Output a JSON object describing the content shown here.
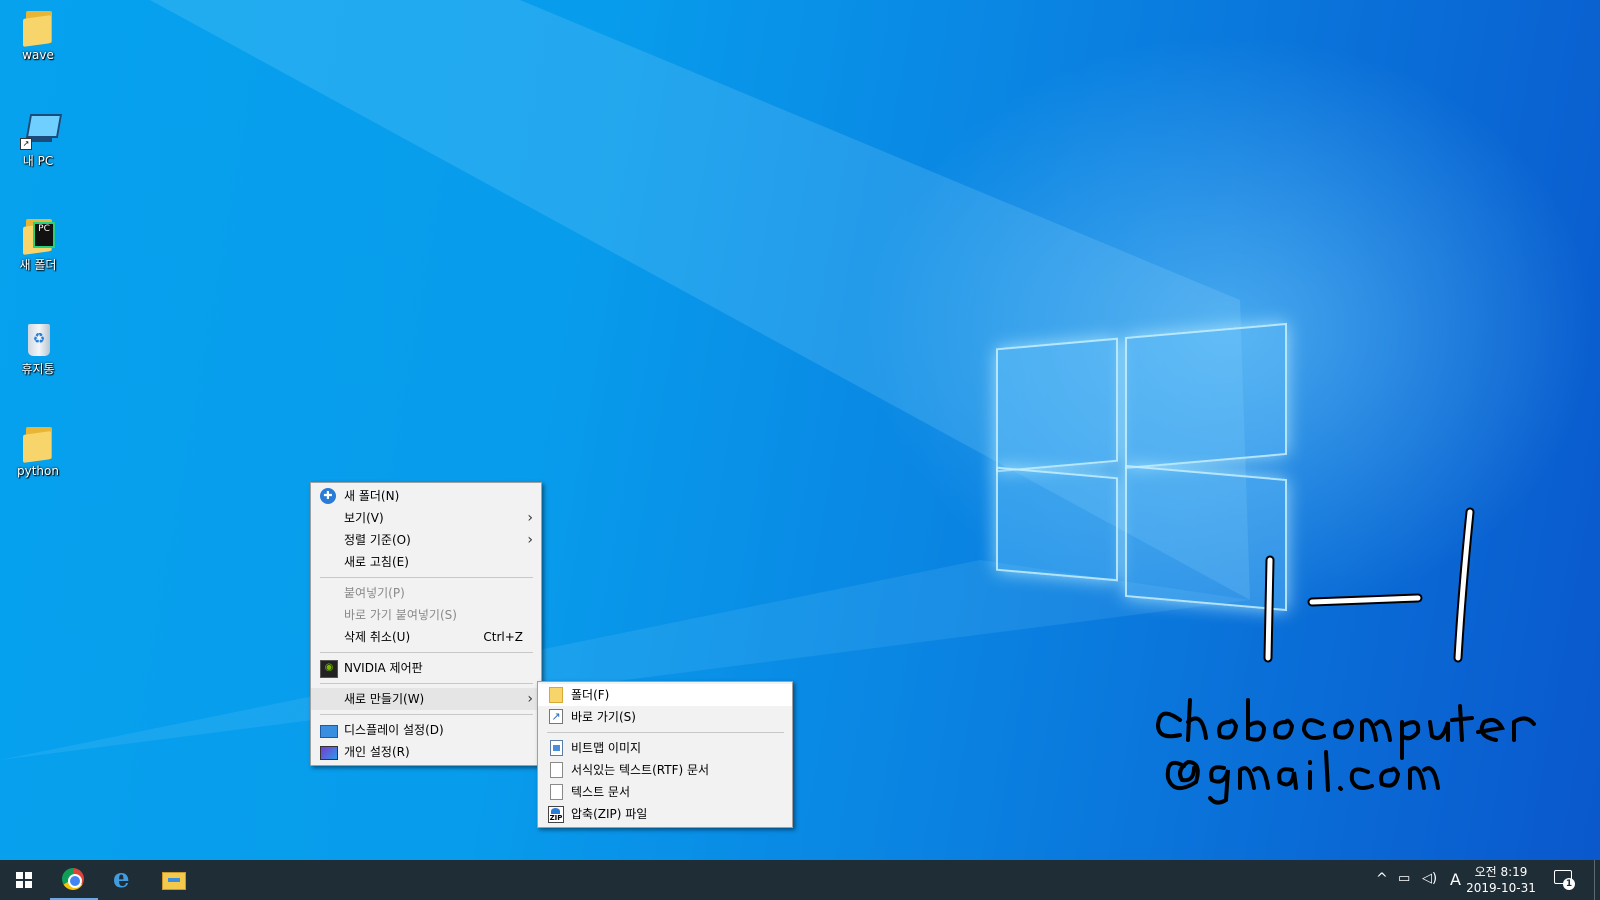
{
  "desktop_icons": [
    {
      "label": "wave",
      "icon": "folder-icon"
    },
    {
      "label": "내 PC",
      "icon": "computer-icon"
    },
    {
      "label": "새 폴더",
      "icon": "pycharm-folder-icon"
    },
    {
      "label": "휴지통",
      "icon": "recycle-bin-icon"
    },
    {
      "label": "python",
      "icon": "folder-icon"
    }
  ],
  "context_menu": {
    "items": [
      {
        "label": "새 폴더(N)",
        "icon": "new-folder-icon"
      },
      {
        "label": "보기(V)",
        "submenu": true
      },
      {
        "label": "정렬 기준(O)",
        "submenu": true
      },
      {
        "label": "새로 고침(E)"
      },
      {
        "label": "붙여넣기(P)",
        "disabled": true
      },
      {
        "label": "바로 가기 붙여넣기(S)",
        "disabled": true
      },
      {
        "label": "삭제 취소(U)",
        "shortcut": "Ctrl+Z"
      },
      {
        "label": "NVIDIA 제어판",
        "icon": "nvidia-icon"
      },
      {
        "label": "새로 만들기(W)",
        "submenu": true,
        "highlighted": true
      },
      {
        "label": "디스플레이 설정(D)",
        "icon": "display-icon"
      },
      {
        "label": "개인 설정(R)",
        "icon": "personalize-icon"
      }
    ]
  },
  "new_submenu": {
    "items": [
      {
        "label": "폴더(F)",
        "icon": "folder-icon",
        "highlighted": true
      },
      {
        "label": "바로 가기(S)",
        "icon": "shortcut-icon"
      },
      {
        "label": "비트맵 이미지",
        "icon": "bitmap-icon"
      },
      {
        "label": "서식있는 텍스트(RTF) 문서",
        "icon": "rtf-document-icon"
      },
      {
        "label": "텍스트 문서",
        "icon": "text-document-icon"
      },
      {
        "label": "압축(ZIP) 파일",
        "icon": "zip-icon"
      }
    ]
  },
  "taskbar": {
    "apps": [
      "start-icon",
      "chrome-icon",
      "edge-icon",
      "file-explorer-icon"
    ],
    "tray": {
      "ime": "A",
      "time": "오전 8:19",
      "date": "2019-10-31",
      "notification_count": "1"
    }
  },
  "colors": {
    "taskbar": "#1f2d36",
    "menu_bg": "#f2f2f2",
    "accent": "#0a78dc"
  }
}
